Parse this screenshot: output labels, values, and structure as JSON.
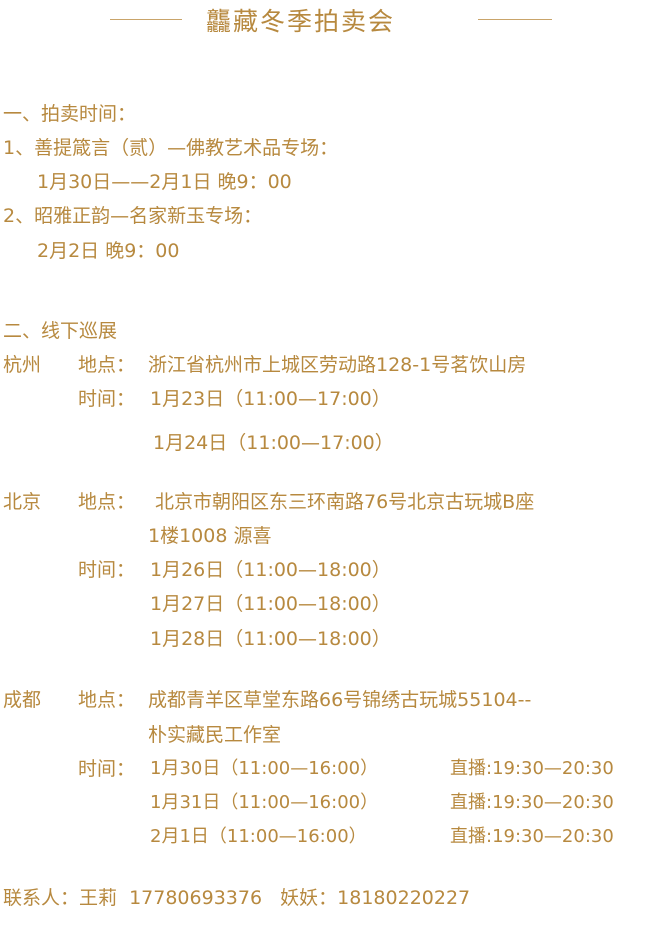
{
  "title": "龘藏冬季拍卖会",
  "section1": {
    "heading": "一、拍卖时间：",
    "item1_title": "1、善提箴言（贰）—佛教艺术品专场：",
    "item1_time": "1月30日——2月1日 晚9：00",
    "item2_title": "2、昭雅正韵—名家新玉专场：",
    "item2_time": "2月2日 晚9：00"
  },
  "section2": {
    "heading": "二、线下巡展",
    "hangzhou": {
      "city": "杭州",
      "address_label": "地点：",
      "address": "浙江省杭州市上城区劳动路128-1号茗饮山房",
      "time_label": "时间：",
      "times": [
        "1月23日（11:00—17:00）",
        "1月24日（11:00—17:00）"
      ]
    },
    "beijing": {
      "city": "北京",
      "address_label": "地点：",
      "address_line1": "北京市朝阳区东三环南路76号北京古玩城B座",
      "address_line2": "1楼1008 源喜",
      "time_label": "时间：",
      "times": [
        "1月26日（11:00—18:00）",
        "1月27日（11:00—18:00）",
        "1月28日（11:00—18:00）"
      ]
    },
    "chengdu": {
      "city": "成都",
      "address_label": "地点：",
      "address_line1": "成都青羊区草堂东路66号锦绣古玩城55104--",
      "address_line2": "朴实藏民工作室",
      "time_label": "时间：",
      "times": [
        "1月30日（11:00—16:00）",
        "1月31日（11:00—16:00）",
        "2月1日（11:00—16:00）"
      ],
      "live": [
        "直播:19:30—20:30",
        "直播:19:30—20:30",
        "直播:19:30—20:30"
      ]
    }
  },
  "contact": "联系人：王莉  17780693376   妖妖：18180220227",
  "colors": {
    "text": "#b7893f",
    "rule": "#c9a46a",
    "background": "#ffffff"
  }
}
